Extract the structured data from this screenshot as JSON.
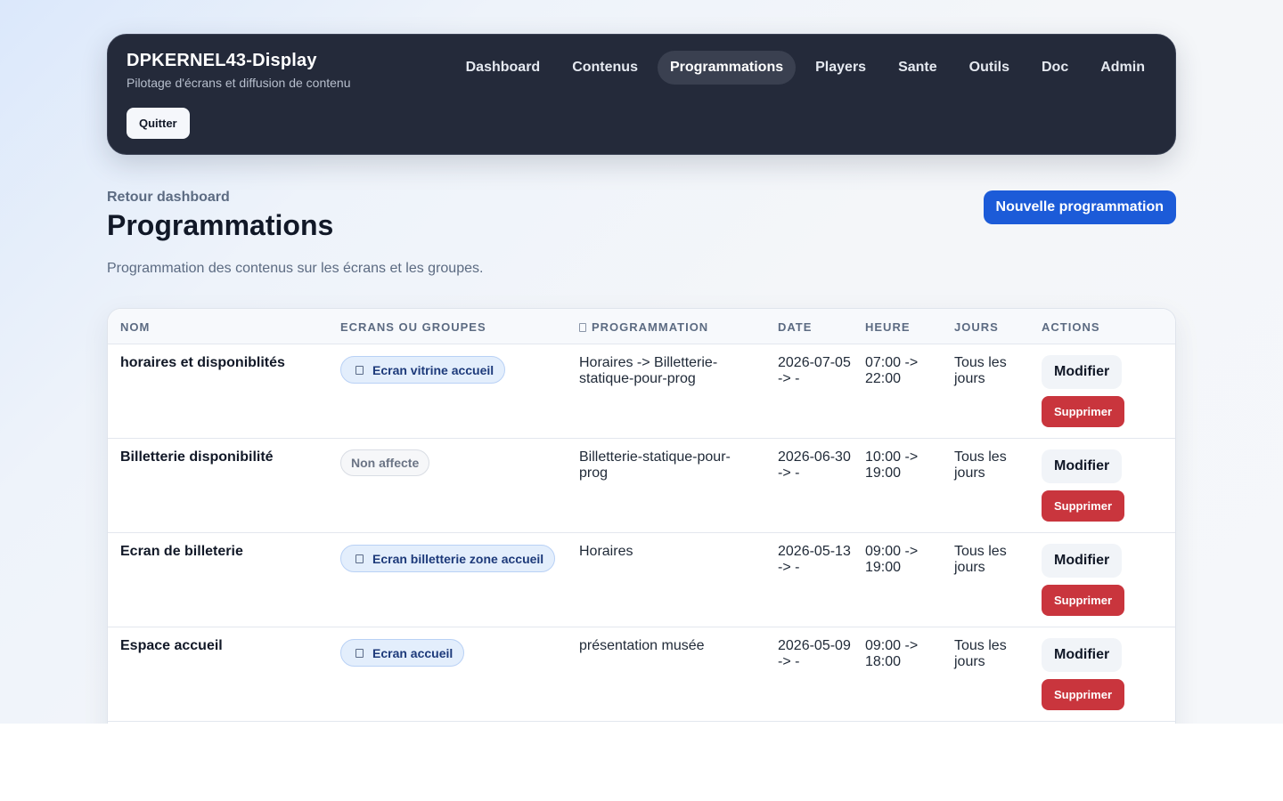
{
  "header": {
    "brand_title": "DPKERNEL43-Display",
    "brand_subtitle": "Pilotage d'écrans et diffusion de contenu",
    "nav": [
      {
        "label": "Dashboard"
      },
      {
        "label": "Contenus"
      },
      {
        "label": "Programmations",
        "active": true
      },
      {
        "label": "Players"
      },
      {
        "label": "Sante"
      },
      {
        "label": "Outils"
      },
      {
        "label": "Doc"
      },
      {
        "label": "Admin"
      }
    ],
    "quit_label": "Quitter"
  },
  "page": {
    "back_label": "Retour dashboard",
    "title": "Programmations",
    "description": "Programmation des contenus sur les écrans et les groupes.",
    "new_button_label": "Nouvelle programmation"
  },
  "table": {
    "columns": {
      "name": "NOM",
      "targets": "ECRANS OU GROUPES",
      "program": "PROGRAMMATION",
      "date": "DATE",
      "time": "HEURE",
      "days": "JOURS",
      "actions": "ACTIONS"
    },
    "modify_label": "Modifier",
    "delete_label": "Supprimer",
    "rows": [
      {
        "name": "horaires et disponiblités",
        "target": "Ecran vitrine accueil",
        "program": "Horaires -> Billetterie-statique-pour-prog",
        "date": "2026-07-05 -> -",
        "time": "07:00 -> 22:00",
        "days": "Tous les jours"
      },
      {
        "name": "Billetterie disponibilité",
        "target": "Non affecte",
        "program": "Billetterie-statique-pour-prog",
        "date": "2026-06-30 -> -",
        "time": "10:00 -> 19:00",
        "days": "Tous les jours"
      },
      {
        "name": "Ecran de billeterie",
        "target": "Ecran billetterie zone accueil",
        "program": "Horaires",
        "date": "2026-05-13 -> -",
        "time": "09:00 -> 19:00",
        "days": "Tous les jours"
      },
      {
        "name": "Espace accueil",
        "target": "Ecran accueil",
        "program": "présentation musée",
        "date": "2026-05-09 -> -",
        "time": "09:00 -> 18:00",
        "days": "Tous les jours"
      }
    ]
  }
}
